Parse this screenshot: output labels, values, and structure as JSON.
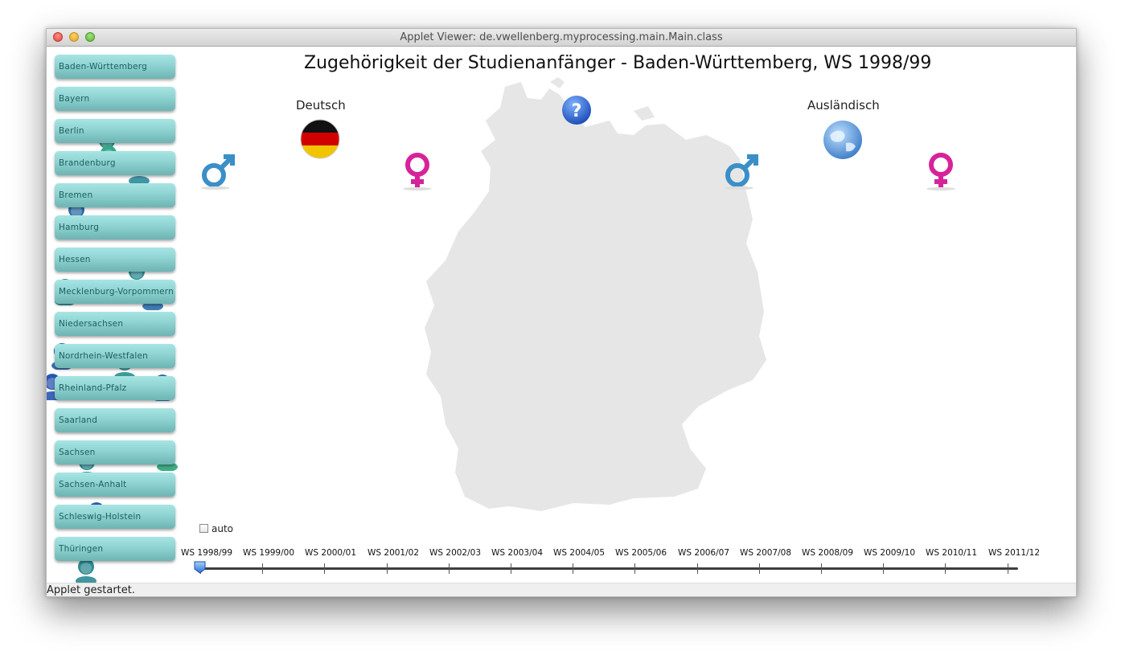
{
  "window": {
    "title": "Applet Viewer: de.vwellenberg.myprocessing.main.Main.class"
  },
  "status": {
    "text": "Applet gestartet."
  },
  "chart": {
    "title": "Zugehörigkeit der Studienanfänger - Baden-Württemberg, WS 1998/99"
  },
  "columns": {
    "german": "Deutsch",
    "foreign": "Ausländisch"
  },
  "icons": {
    "help": "question-mark-icon",
    "german_flag": "german-flag-icon",
    "globe": "globe-icon",
    "male": "male-symbol-icon",
    "female": "female-symbol-icon",
    "person": "person-icon"
  },
  "colors": {
    "male": "#3b8fc7",
    "female": "#d6239a",
    "button": "#8ed3d2",
    "map": "#e6e6e6"
  },
  "states": [
    "Baden-Württemberg",
    "Bayern",
    "Berlin",
    "Brandenburg",
    "Bremen",
    "Hamburg",
    "Hessen",
    "Mecklenburg-Vorpommern",
    "Niedersachsen",
    "Nordrhein-Westfalen",
    "Rheinland-Pfalz",
    "Saarland",
    "Sachsen",
    "Sachsen-Anhalt",
    "Schleswig-Holstein",
    "Thüringen"
  ],
  "auto": {
    "label": "auto",
    "checked": false
  },
  "timeline": {
    "semesters": [
      "WS 1998/99",
      "WS 1999/00",
      "WS 2000/01",
      "WS 2001/02",
      "WS 2002/03",
      "WS 2003/04",
      "WS 2004/05",
      "WS 2005/06",
      "WS 2006/07",
      "WS 2007/08",
      "WS 2008/09",
      "WS 2009/10",
      "WS 2010/11",
      "WS 2011/12"
    ],
    "selected_index": 0
  }
}
